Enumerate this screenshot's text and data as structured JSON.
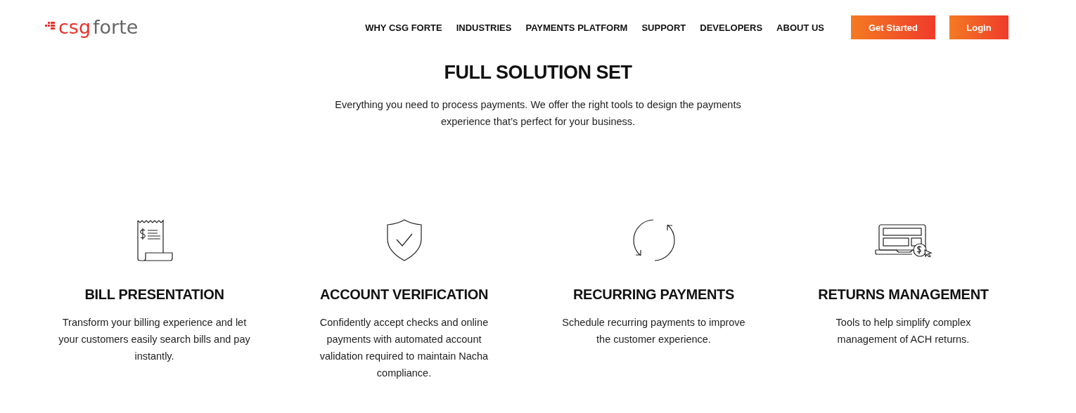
{
  "logo": {
    "brand": "csg",
    "name": "forte"
  },
  "nav": {
    "links": [
      "WHY CSG FORTE",
      "INDUSTRIES",
      "PAYMENTS PLATFORM",
      "SUPPORT",
      "DEVELOPERS",
      "ABOUT US"
    ],
    "buttons": [
      "Get Started",
      "Login"
    ]
  },
  "intro": {
    "title": "FULL SOLUTION SET",
    "text": "Everything you need to process payments. We offer the right tools to design the payments experience that’s perfect for your business."
  },
  "features": [
    {
      "kind": "receipt",
      "title": "BILL PRESENTATION",
      "text": "Transform your billing experience and let your customers easily search bills and pay instantly."
    },
    {
      "kind": "shield",
      "title": "ACCOUNT VERIFICATION",
      "text": "Confidently accept checks and online payments with automated account validation required to maintain Nacha compliance."
    },
    {
      "kind": "cycle",
      "title": "RECURRING PAYMENTS",
      "text": "Schedule recurring payments to improve the customer experience."
    },
    {
      "kind": "laptop",
      "title": "RETURNS MANAGEMENT",
      "text": "Tools to help simplify complex management of ACH returns."
    }
  ]
}
